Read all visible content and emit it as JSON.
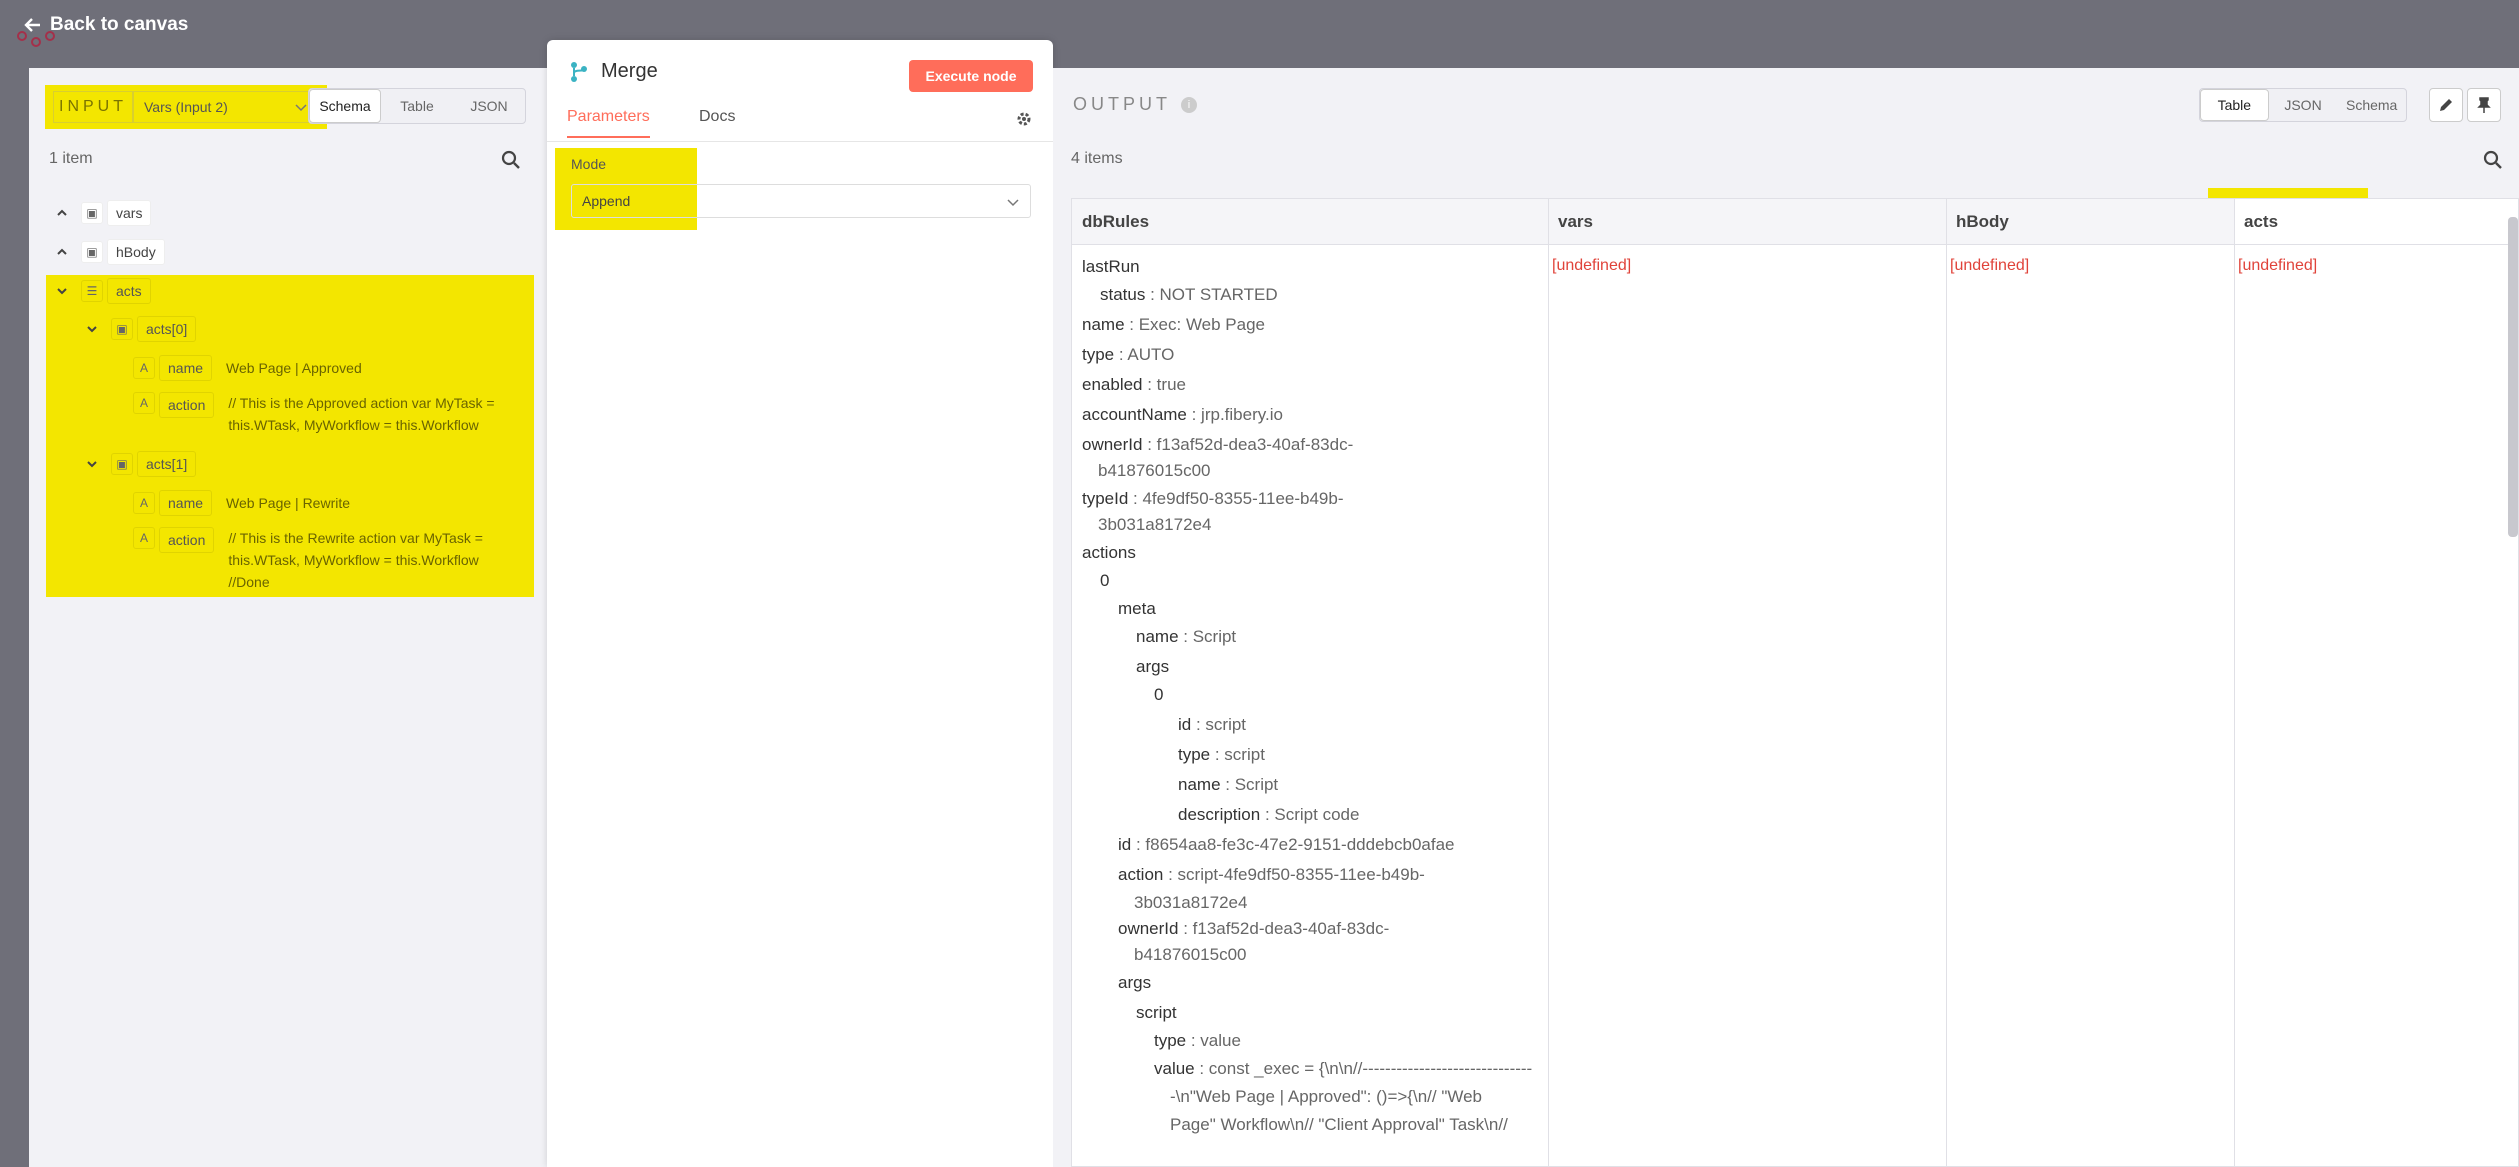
{
  "topbar": {
    "back_label": "Back to canvas"
  },
  "input": {
    "label": "INPUT",
    "select_value": "Vars (Input 2)",
    "views": [
      "Schema",
      "Table",
      "JSON"
    ],
    "active_view": "Schema",
    "count": "1 item",
    "tree": {
      "vars": "vars",
      "hBody": "hBody",
      "acts": "acts",
      "acts0": "acts[0]",
      "acts1": "acts[1]",
      "name_key": "name",
      "action_key": "action",
      "acts0_name": "Web Page | Approved",
      "acts0_action_1": "// This is the Approved action var MyTask =",
      "acts0_action_2": "this.WTask, MyWorkflow = this.Workflow",
      "acts1_name": "Web Page | Rewrite",
      "acts1_action_1": "// This is the Rewrite action var MyTask =",
      "acts1_action_2": "this.WTask, MyWorkflow = this.Workflow",
      "acts1_action_3": "//Done"
    }
  },
  "node": {
    "title": "Merge",
    "execute_label": "Execute node",
    "tabs": [
      "Parameters",
      "Docs"
    ],
    "mode_label": "Mode",
    "mode_value": "Append"
  },
  "output": {
    "title": "OUTPUT",
    "views": [
      "Table",
      "JSON",
      "Schema"
    ],
    "active_view": "Table",
    "count": "4 items",
    "columns": [
      "dbRules",
      "vars",
      "hBody",
      "acts"
    ],
    "undefined": "[undefined]",
    "rows": [
      {
        "k": "lastRun",
        "v": ""
      },
      {
        "k": "status",
        "v": " : NOT STARTED"
      },
      {
        "k": "name",
        "v": " : Exec: Web Page"
      },
      {
        "k": "type",
        "v": " : AUTO"
      },
      {
        "k": "enabled",
        "v": " : true"
      },
      {
        "k": "accountName",
        "v": " : jrp.fibery.io"
      },
      {
        "k": "ownerId",
        "v": " : f13af52d-dea3-40af-83dc-"
      },
      {
        "k": "",
        "v": "b41876015c00"
      },
      {
        "k": "typeId",
        "v": " : 4fe9df50-8355-11ee-b49b-"
      },
      {
        "k": "",
        "v": "3b031a8172e4"
      },
      {
        "k": "actions",
        "v": ""
      },
      {
        "k": "0",
        "v": ""
      },
      {
        "k": "meta",
        "v": ""
      },
      {
        "k": "name",
        "v": " : Script"
      },
      {
        "k": "args",
        "v": ""
      },
      {
        "k": "0",
        "v": ""
      },
      {
        "k": "id",
        "v": " : script"
      },
      {
        "k": "type",
        "v": " : script"
      },
      {
        "k": "name",
        "v": " : Script"
      },
      {
        "k": "description",
        "v": " : Script code"
      },
      {
        "k": "id",
        "v": " : f8654aa8-fe3c-47e2-9151-dddebcb0afae"
      },
      {
        "k": "action",
        "v": " : script-4fe9df50-8355-11ee-b49b-"
      },
      {
        "k": "",
        "v": "3b031a8172e4"
      },
      {
        "k": "ownerId",
        "v": " : f13af52d-dea3-40af-83dc-"
      },
      {
        "k": "",
        "v": "b41876015c00"
      },
      {
        "k": "args",
        "v": ""
      },
      {
        "k": "script",
        "v": ""
      },
      {
        "k": "type",
        "v": " : value"
      },
      {
        "k": "value",
        "v": " : const _exec = {\\n\\n//------------------------------"
      },
      {
        "k": "",
        "v": "-\\n\"Web Page | Approved\": ()=>{\\n// \"Web"
      },
      {
        "k": "",
        "v": "Page\" Workflow\\n// \"Client Approval\" Task\\n//"
      }
    ]
  }
}
